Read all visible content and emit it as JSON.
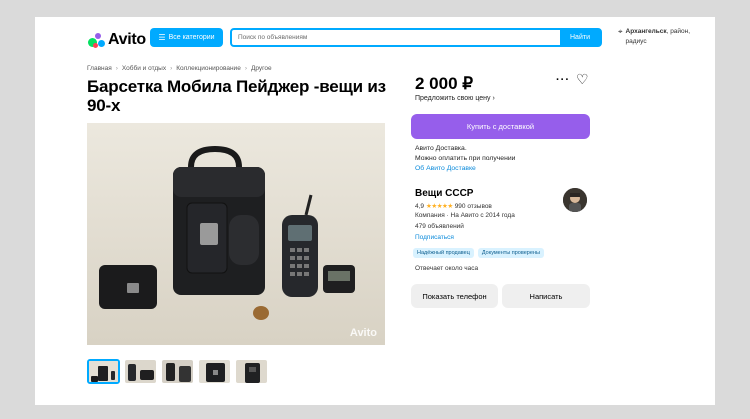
{
  "header": {
    "logo_text": "Avito",
    "categories_label": "Все категории",
    "search_placeholder": "Поиск по объявлениям",
    "search_button": "Найти",
    "location_city": "Архангельск",
    "location_rest": ", район, радиус"
  },
  "breadcrumbs": [
    "Главная",
    "Хобби и отдых",
    "Коллекционирование",
    "Другое"
  ],
  "listing": {
    "title": "Барсетка Мобила Пейджер -вещи из 90-х",
    "price": "2 000 ₽",
    "offer_price": "Предложить свою цену ›",
    "watermark": "Avito",
    "thumbnail_count": 5
  },
  "actions": {
    "buy_delivery": "Купить с доставкой",
    "delivery_line1": "Авито Доставка.",
    "delivery_line2": "Можно оплатить при получении",
    "delivery_link": "Об Авито Доставке",
    "show_phone": "Показать телефон",
    "write_message": "Написать"
  },
  "seller": {
    "name": "Вещи СССР",
    "rating": "4,9",
    "stars": "★★★★★",
    "reviews": "990 отзывов",
    "company": "Компания · На Авито с 2014 года",
    "ads": "479 объявлений",
    "subscribe": "Подписаться",
    "badges": [
      "Надёжный продавец",
      "Документы проверены"
    ],
    "reply_time": "Отвечает около часа"
  },
  "colors": {
    "accent_blue": "#00aaff",
    "buy_purple": "#965eeb",
    "link_blue": "#0a8adb",
    "star_yellow": "#ffb021"
  }
}
